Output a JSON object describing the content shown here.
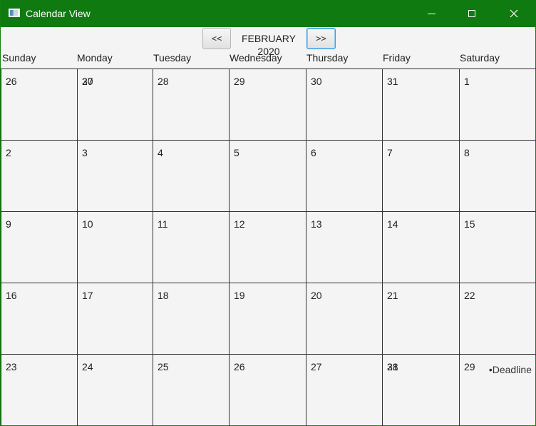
{
  "window": {
    "title": "Calendar View",
    "icon": "app-window-icon",
    "title_bar_color": "#0f7a0f"
  },
  "nav": {
    "prev_label": "<<",
    "next_label": ">>",
    "month_label": "FEBRUARY 2020"
  },
  "day_names": [
    "Sunday",
    "Monday",
    "Tuesday",
    "Wednesday",
    "Thursday",
    "Friday",
    "Saturday"
  ],
  "weeks": [
    [
      "26",
      "27",
      "28",
      "29",
      "30",
      "31",
      "1"
    ],
    [
      "2",
      "3",
      "4",
      "5",
      "6",
      "7",
      "8"
    ],
    [
      "9",
      "10",
      "11",
      "12",
      "13",
      "14",
      "15"
    ],
    [
      "16",
      "17",
      "18",
      "19",
      "20",
      "21",
      "22"
    ],
    [
      "23",
      "24",
      "25",
      "26",
      "27",
      "28",
      "29"
    ]
  ],
  "overlays": [
    {
      "week": 0,
      "day": 1,
      "text": "30"
    },
    {
      "week": 4,
      "day": 5,
      "text": "31"
    }
  ],
  "events": [
    {
      "week": 4,
      "day": 6,
      "text": "•Deadline"
    }
  ]
}
